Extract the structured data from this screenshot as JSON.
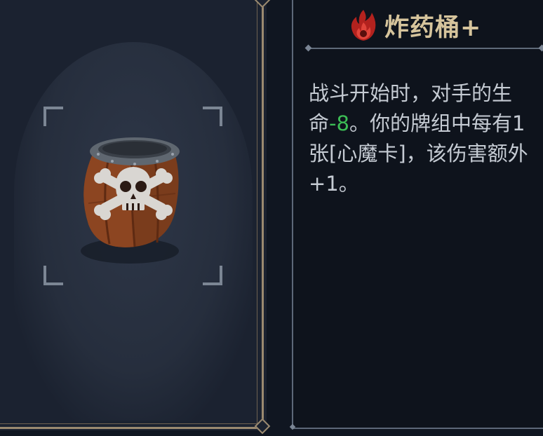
{
  "card": {
    "title": "炸药桶+",
    "description": {
      "part1": "战斗开始时，对手的生命",
      "value": "-8",
      "part2": "。你的牌组中每有1张[心魔卡]，该伤害额外+1。"
    },
    "art_icon": "powder-keg-skull-barrel",
    "rarity_icon": "red-flame-icon"
  },
  "colors": {
    "title": "#d6c49c",
    "value_negative": "#3cbe55",
    "frame": "#9b8a70"
  }
}
